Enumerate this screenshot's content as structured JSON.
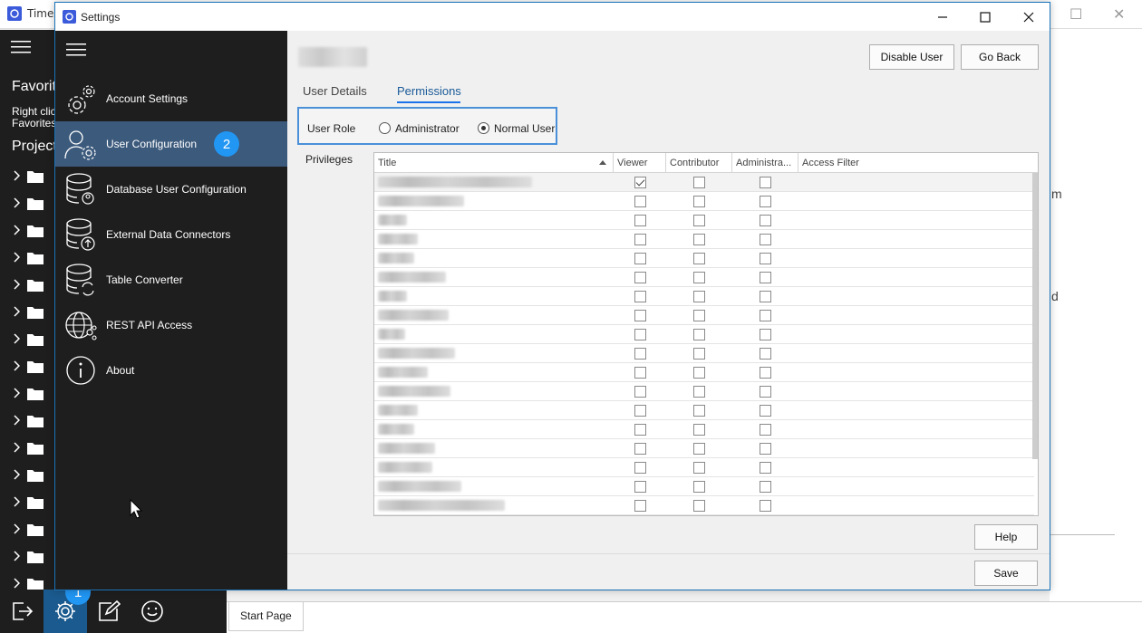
{
  "background_app": {
    "title": "TimeX",
    "icon": "app-logo-icon",
    "sidebar": {
      "favorites_heading": "Favorites",
      "favorites_hint_line1": "Right click",
      "favorites_hint_line2": "Favorites",
      "projects_heading": "Projects",
      "folder_count": 16
    },
    "content_fragments": [
      "m",
      "d"
    ],
    "start_tab": "Start Page",
    "bottom_badge": "1"
  },
  "window": {
    "title": "Settings",
    "icon": "settings-app-icon",
    "controls": [
      "minimize-icon",
      "maximize-icon",
      "close-icon"
    ]
  },
  "nav": {
    "items": [
      {
        "label": "Account Settings",
        "icon": "gear-settings-icon"
      },
      {
        "label": "User Configuration",
        "icon": "user-gear-icon",
        "active": true,
        "badge": "2"
      },
      {
        "label": "Database User Configuration",
        "icon": "database-user-icon"
      },
      {
        "label": "External Data Connectors",
        "icon": "database-upload-icon"
      },
      {
        "label": "Table Converter",
        "icon": "database-refresh-icon"
      },
      {
        "label": "REST API Access",
        "icon": "globe-network-icon"
      },
      {
        "label": "About",
        "icon": "info-icon"
      }
    ]
  },
  "header": {
    "disable_user_label": "Disable User",
    "go_back_label": "Go Back"
  },
  "tabs": [
    {
      "label": "User Details",
      "active": false
    },
    {
      "label": "Permissions",
      "active": true
    }
  ],
  "user_role": {
    "label": "User Role",
    "options": [
      {
        "label": "Administrator",
        "selected": false
      },
      {
        "label": "Normal User",
        "selected": true
      }
    ]
  },
  "privileges": {
    "label": "Privileges",
    "columns": [
      "Title",
      "Viewer",
      "Contributor",
      "Administra...",
      "Access Filter"
    ],
    "rows": [
      {
        "viewer": true,
        "contributor": false,
        "administrator": false
      },
      {
        "viewer": false,
        "contributor": false,
        "administrator": false
      },
      {
        "viewer": false,
        "contributor": false,
        "administrator": false
      },
      {
        "viewer": false,
        "contributor": false,
        "administrator": false
      },
      {
        "viewer": false,
        "contributor": false,
        "administrator": false
      },
      {
        "viewer": false,
        "contributor": false,
        "administrator": false
      },
      {
        "viewer": false,
        "contributor": false,
        "administrator": false
      },
      {
        "viewer": false,
        "contributor": false,
        "administrator": false
      },
      {
        "viewer": false,
        "contributor": false,
        "administrator": false
      },
      {
        "viewer": false,
        "contributor": false,
        "administrator": false
      },
      {
        "viewer": false,
        "contributor": false,
        "administrator": false
      },
      {
        "viewer": false,
        "contributor": false,
        "administrator": false
      },
      {
        "viewer": false,
        "contributor": false,
        "administrator": false
      },
      {
        "viewer": false,
        "contributor": false,
        "administrator": false
      },
      {
        "viewer": false,
        "contributor": false,
        "administrator": false
      },
      {
        "viewer": false,
        "contributor": false,
        "administrator": false
      },
      {
        "viewer": false,
        "contributor": false,
        "administrator": false
      },
      {
        "viewer": false,
        "contributor": false,
        "administrator": false
      }
    ]
  },
  "footer": {
    "help_label": "Help",
    "save_label": "Save"
  },
  "colors": {
    "nav_bg": "#1e1e1e",
    "nav_active": "#3c5a7c",
    "accent": "#1a73e8",
    "badge": "#2196f3"
  }
}
